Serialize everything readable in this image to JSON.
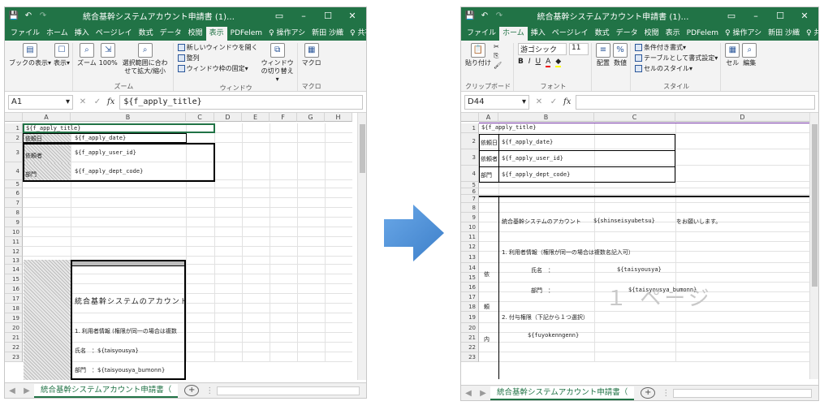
{
  "windows": [
    {
      "title": "統合基幹システムアカウント申請書 (1)…",
      "tabs": [
        "ファイル",
        "ホーム",
        "挿入",
        "ページレイ",
        "数式",
        "データ",
        "校閲",
        "表示",
        "PDFelem",
        "♀ 操作アシ",
        "新田 沙織",
        "♀ 共有"
      ],
      "active_tab": "表示",
      "ribbon_groups": [
        {
          "label": "ブックの表示",
          "buttons": [
            "ブックの表示▾",
            "表示▾"
          ]
        },
        {
          "label": "ズーム",
          "buttons": [
            "ズーム",
            "100%",
            "選択範囲に合わせて拡大/縮小"
          ]
        },
        {
          "label": "ウィンドウ",
          "items": [
            "新しいウィンドウを開く",
            "整列",
            "ウィンドウ枠の固定▾"
          ],
          "buttons": [
            "ウィンドウの切り替え▾"
          ]
        },
        {
          "label": "マクロ",
          "buttons": [
            "マクロ"
          ]
        }
      ],
      "name_box": "A1",
      "formula": "${f_apply_title}",
      "columns": [
        "A",
        "B",
        "C",
        "D",
        "E",
        "F",
        "G",
        "H"
      ],
      "rows": [
        "1",
        "2",
        "3",
        "4",
        "5",
        "6",
        "7",
        "8",
        "9",
        "10",
        "11",
        "12",
        "13",
        "14",
        "15",
        "16",
        "17",
        "18",
        "19",
        "20",
        "21",
        "22",
        "23"
      ],
      "cells": {
        "a1": "${f_apply_title}",
        "a2": "依頼日",
        "b2": "${f_apply_date}",
        "a3": "依頼者",
        "b3": "${f_apply_user_id}",
        "a4": "部門",
        "b4": "${f_apply_dept_code}",
        "b15": "統合基幹システムのアカウント",
        "b18": "1. 利用者情報 (権限が同一の場合は複数",
        "b20": "氏名　：${taisyousya}",
        "b22": "部門　：${taisyousya_bumonn}"
      },
      "sheet_tab": "統合基幹システムアカウント申請書（"
    },
    {
      "title": "統合基幹システムアカウント申請書 (1)…",
      "tabs": [
        "ファイル",
        "ホーム",
        "挿入",
        "ページレイ",
        "数式",
        "データ",
        "校閲",
        "表示",
        "PDFelem",
        "♀ 操作アシ",
        "新田 沙織",
        "♀ 共有"
      ],
      "active_tab": "ホーム",
      "ribbon_groups": [
        {
          "label": "クリップボード",
          "buttons": [
            "貼り付け"
          ]
        },
        {
          "label": "フォント",
          "font_name": "游ゴシック",
          "font_size": "11",
          "buttons": [
            "B",
            "I",
            "U",
            "A",
            "A"
          ]
        },
        {
          "label": "",
          "buttons": [
            "配置",
            "数値"
          ]
        },
        {
          "label": "スタイル",
          "items": [
            "条件付き書式▾",
            "テーブルとして書式設定▾",
            "セルのスタイル▾"
          ]
        },
        {
          "label": "",
          "buttons": [
            "セル",
            "編集"
          ]
        }
      ],
      "name_box": "D44",
      "formula": "",
      "columns": [
        "A",
        "B",
        "C",
        "D"
      ],
      "rows": [
        "1",
        "2",
        "3",
        "4",
        "5",
        "6",
        "7",
        "8",
        "9",
        "10",
        "11",
        "12",
        "13",
        "14",
        "15",
        "16",
        "17",
        "18",
        "19",
        "20",
        "21",
        "22",
        "23"
      ],
      "cells": {
        "a1": "${f_apply_title}",
        "a2": "依頼日",
        "b2": "${f_apply_date}",
        "a3": "依頼者",
        "b3": "${f_apply_user_id}",
        "a4": "部門",
        "b4": "${f_apply_dept_code}",
        "b8": "統合基幹システムのアカウント",
        "c8": "${shinseisyubetsu}",
        "d8": "をお願いします。",
        "b11": "1. 利用者情報（権限が同一の場合は複数名記入可）",
        "a13": "依",
        "b13": "氏名　：",
        "c13": "${taisyousya}",
        "b16": "部門　：",
        "c16": "${taisyousya_bumonn}",
        "a17": "頼",
        "b18": "2. 付与権限（下記から１つ選択）",
        "a20": "内",
        "b20": "${fuyokenngenn}",
        "page_watermark": "１ ページ"
      },
      "sheet_tab": "統合基幹システムアカウント申請書（"
    }
  ],
  "colors": {
    "excel_green": "#217346",
    "arrow": "#4a90d9"
  }
}
